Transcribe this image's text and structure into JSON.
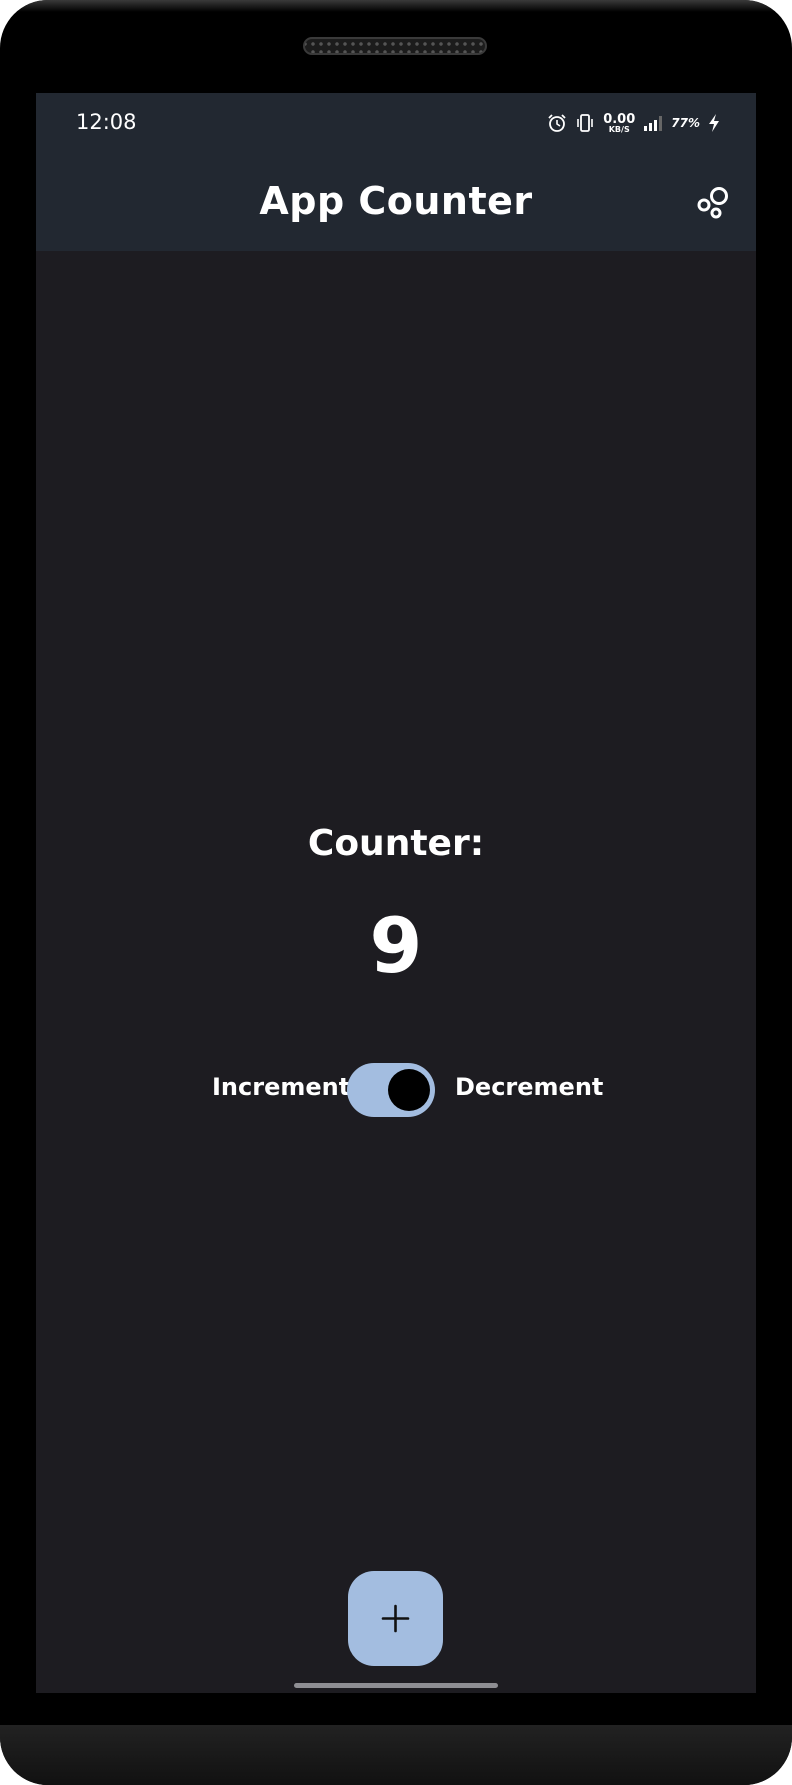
{
  "status_bar": {
    "time": "12:08",
    "speed_value": "0.00",
    "speed_unit": "KB/S",
    "battery": "77%",
    "icons": [
      "alarm-icon",
      "vibrate-icon",
      "signal-icon",
      "charging-icon"
    ]
  },
  "app_bar": {
    "title": "App Counter",
    "action_icon": "settings-bubbles-icon"
  },
  "main": {
    "counter_label": "Counter:",
    "counter_value": "9",
    "toggle": {
      "left_label": "Increment",
      "right_label": "Decrement",
      "on": true
    }
  },
  "fab": {
    "icon": "plus-icon"
  },
  "colors": {
    "app_bar": "#222831",
    "background": "#1d1c21",
    "accent": "#a3bde0",
    "text": "#ffffff"
  }
}
